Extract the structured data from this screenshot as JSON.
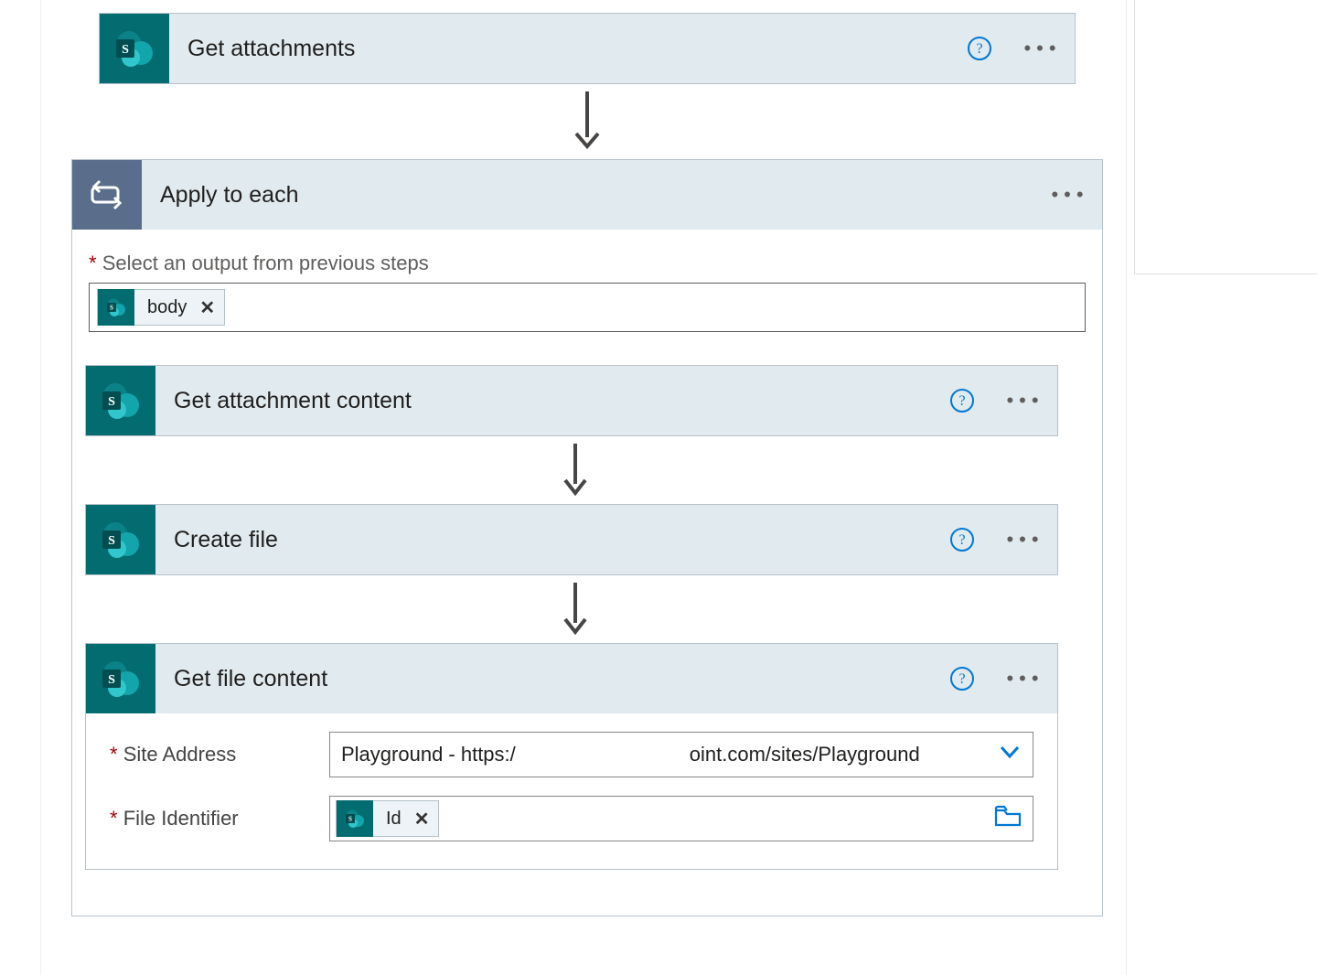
{
  "steps": {
    "get_attachments": {
      "title": "Get attachments"
    },
    "apply_to_each": {
      "title": "Apply to each",
      "select_label": "Select an output from previous steps",
      "token": {
        "label": "body"
      }
    },
    "get_attachment_content": {
      "title": "Get attachment content"
    },
    "create_file": {
      "title": "Create file"
    },
    "get_file_content": {
      "title": "Get file content",
      "params": {
        "site_label": "Site Address",
        "site_value_left": "Playground - https:/",
        "site_value_right": "oint.com/sites/Playground",
        "file_id_label": "File Identifier",
        "file_id_token": "Id"
      }
    }
  }
}
